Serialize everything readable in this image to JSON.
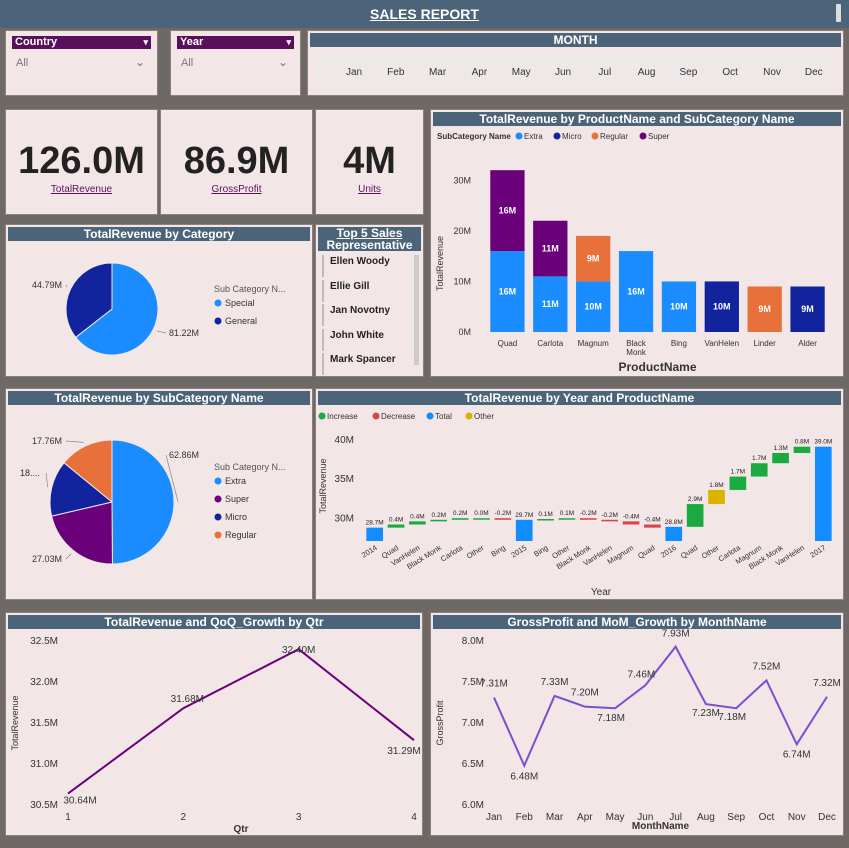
{
  "title": "SALES REPORT",
  "slicers": {
    "country": {
      "label": "Country",
      "value": "All"
    },
    "year": {
      "label": "Year",
      "value": "All"
    },
    "month": {
      "label": "MONTH",
      "months": [
        "Jan",
        "Feb",
        "Mar",
        "Apr",
        "May",
        "Jun",
        "Jul",
        "Aug",
        "Sep",
        "Oct",
        "Nov",
        "Dec"
      ]
    }
  },
  "kpis": {
    "revenue": {
      "value": "126.0M",
      "label": "TotalRevenue"
    },
    "profit": {
      "value": "86.9M",
      "label": "GrossProfit"
    },
    "units": {
      "value": "4M",
      "label": "Units"
    }
  },
  "reps": {
    "title_line1": "Top 5 Sales",
    "title_line2": "Representative",
    "items": [
      "Ellen Woody",
      "Ellie Gill",
      "Jan Novotny",
      "John White",
      "Mark Spancer"
    ]
  },
  "colors": {
    "extra": "#1a8cff",
    "micro": "#12239e",
    "regular": "#e8703a",
    "super": "#6b007b",
    "increase": "#1aab40",
    "decrease": "#d64550",
    "total": "#118dff",
    "other": "#d9b300",
    "line": "#6b007b",
    "line2": "#7a4fd0"
  },
  "chart_data": [
    {
      "id": "cat-pie",
      "type": "pie",
      "title": "TotalRevenue by Category",
      "legend_title": "Sub Category N...",
      "labels": [
        "Special",
        "General"
      ],
      "values": [
        81.22,
        44.79
      ],
      "data_labels": [
        "81.22M",
        "44.79M"
      ]
    },
    {
      "id": "prod-bar",
      "type": "bar",
      "title": "TotalRevenue by ProductName and SubCategory Name",
      "legend_title": "SubCategory Name",
      "legend": [
        "Extra",
        "Micro",
        "Regular",
        "Super"
      ],
      "xlabel": "ProductName",
      "ylabel": "TotalRevenue",
      "ylim": [
        0,
        35
      ],
      "yticks": [
        "0M",
        "10M",
        "20M",
        "30M"
      ],
      "categories": [
        "Quad",
        "Carlota",
        "Magnum",
        "Black Monk",
        "Bing",
        "VanHelen",
        "Linder",
        "Alder"
      ],
      "stacks": [
        [
          {
            "s": "Extra",
            "v": 16,
            "label": "16M"
          },
          {
            "s": "Super",
            "v": 16,
            "label": "16M"
          }
        ],
        [
          {
            "s": "Extra",
            "v": 11,
            "label": "11M"
          },
          {
            "s": "Super",
            "v": 11,
            "label": "11M"
          }
        ],
        [
          {
            "s": "Extra",
            "v": 10,
            "label": "10M"
          },
          {
            "s": "Regular",
            "v": 9,
            "label": "9M"
          }
        ],
        [
          {
            "s": "Extra",
            "v": 16,
            "label": "16M"
          }
        ],
        [
          {
            "s": "Extra",
            "v": 10,
            "label": "10M"
          }
        ],
        [
          {
            "s": "Micro",
            "v": 10,
            "label": "10M"
          }
        ],
        [
          {
            "s": "Regular",
            "v": 9,
            "label": "9M"
          }
        ],
        [
          {
            "s": "Micro",
            "v": 9,
            "label": "9M"
          }
        ]
      ]
    },
    {
      "id": "sub-pie",
      "type": "pie",
      "title": "TotalRevenue by SubCategory Name",
      "legend_title": "Sub Category N...",
      "labels": [
        "Extra",
        "Super",
        "Micro",
        "Regular"
      ],
      "values": [
        62.86,
        27.03,
        18.35,
        17.76
      ],
      "data_labels": [
        "62.86M",
        "27.03M",
        "18....",
        "17.76M"
      ]
    },
    {
      "id": "waterfall",
      "type": "bar",
      "title": "TotalRevenue by Year and ProductName",
      "legend": [
        "Increase",
        "Decrease",
        "Total",
        "Other"
      ],
      "xlabel": "Year",
      "ylabel": "TotalRevenue",
      "ylim": [
        27,
        41
      ],
      "yticks": [
        "30M",
        "35M",
        "40M"
      ],
      "steps": [
        {
          "x": "2014",
          "kind": "Total",
          "from": 27,
          "to": 28.7,
          "label": "28.7M"
        },
        {
          "x": "Quad",
          "kind": "Increase",
          "from": 28.7,
          "to": 29.1,
          "label": "0.4M"
        },
        {
          "x": "VanHelen",
          "kind": "Increase",
          "from": 29.1,
          "to": 29.5,
          "label": "0.4M"
        },
        {
          "x": "Black Monk",
          "kind": "Increase",
          "from": 29.5,
          "to": 29.7,
          "label": "0.2M"
        },
        {
          "x": "Carlota",
          "kind": "Increase",
          "from": 29.7,
          "to": 29.9,
          "label": "0.2M"
        },
        {
          "x": "Other",
          "kind": "Increase",
          "from": 29.9,
          "to": 29.9,
          "label": "0.0M"
        },
        {
          "x": "Bing",
          "kind": "Decrease",
          "from": 29.9,
          "to": 29.7,
          "label": "-0.2M"
        },
        {
          "x": "2015",
          "kind": "Total",
          "from": 27,
          "to": 29.7,
          "label": "29.7M"
        },
        {
          "x": "Bing",
          "kind": "Increase",
          "from": 29.7,
          "to": 29.8,
          "label": "0.1M"
        },
        {
          "x": "Other",
          "kind": "Increase",
          "from": 29.8,
          "to": 29.9,
          "label": "0.1M"
        },
        {
          "x": "Black Monk",
          "kind": "Decrease",
          "from": 29.9,
          "to": 29.7,
          "label": "-0.2M"
        },
        {
          "x": "VanHelen",
          "kind": "Decrease",
          "from": 29.7,
          "to": 29.5,
          "label": "-0.2M"
        },
        {
          "x": "Magnum",
          "kind": "Decrease",
          "from": 29.5,
          "to": 29.1,
          "label": "-0.4M"
        },
        {
          "x": "Quad",
          "kind": "Decrease",
          "from": 29.1,
          "to": 28.7,
          "label": "-0.4M"
        },
        {
          "x": "2016",
          "kind": "Total",
          "from": 27,
          "to": 28.8,
          "label": "28.8M"
        },
        {
          "x": "Quad",
          "kind": "Increase",
          "from": 28.8,
          "to": 31.7,
          "label": "2.9M"
        },
        {
          "x": "Other",
          "kind": "Other",
          "from": 31.7,
          "to": 33.5,
          "label": "1.8M"
        },
        {
          "x": "Carlota",
          "kind": "Increase",
          "from": 33.5,
          "to": 35.2,
          "label": "1.7M"
        },
        {
          "x": "Magnum",
          "kind": "Increase",
          "from": 35.2,
          "to": 36.9,
          "label": "1.7M"
        },
        {
          "x": "Black Monk",
          "kind": "Increase",
          "from": 36.9,
          "to": 38.2,
          "label": "1.3M"
        },
        {
          "x": "VanHelen",
          "kind": "Increase",
          "from": 38.2,
          "to": 39.0,
          "label": "0.8M"
        },
        {
          "x": "2017",
          "kind": "Total",
          "from": 27,
          "to": 39.0,
          "label": "39.0M"
        }
      ]
    },
    {
      "id": "qtr-line",
      "type": "line",
      "title": "TotalRevenue and QoQ_Growth by Qtr",
      "xlabel": "Qtr",
      "ylabel": "TotalRevenue",
      "ylim": [
        30.5,
        32.5
      ],
      "yticks": [
        "30.5M",
        "31.0M",
        "31.5M",
        "32.0M",
        "32.5M"
      ],
      "x": [
        "1",
        "2",
        "3",
        "4"
      ],
      "values": [
        30.64,
        31.68,
        32.4,
        31.29
      ],
      "data_labels": [
        "30.64M",
        "31.68M",
        "32.40M",
        "31.29M"
      ]
    },
    {
      "id": "month-line",
      "type": "line",
      "title": "GrossProfit and MoM_Growth by MonthName",
      "xlabel": "MonthName",
      "ylabel": "GrossProfit",
      "ylim": [
        6.0,
        8.0
      ],
      "yticks": [
        "6.0M",
        "6.5M",
        "7.0M",
        "7.5M",
        "8.0M"
      ],
      "x": [
        "Jan",
        "Feb",
        "Mar",
        "Apr",
        "May",
        "Jun",
        "Jul",
        "Aug",
        "Sep",
        "Oct",
        "Nov",
        "Dec"
      ],
      "values": [
        7.31,
        6.48,
        7.33,
        7.2,
        7.18,
        7.46,
        7.93,
        7.23,
        7.18,
        7.52,
        6.74,
        7.32
      ],
      "data_labels": [
        "7.31M",
        "6.48M",
        "7.33M",
        "7.20M",
        "7.18M",
        "7.46M",
        "7.93M",
        "7.23M",
        "7.18M",
        "7.52M",
        "6.74M",
        "7.32M"
      ]
    }
  ]
}
